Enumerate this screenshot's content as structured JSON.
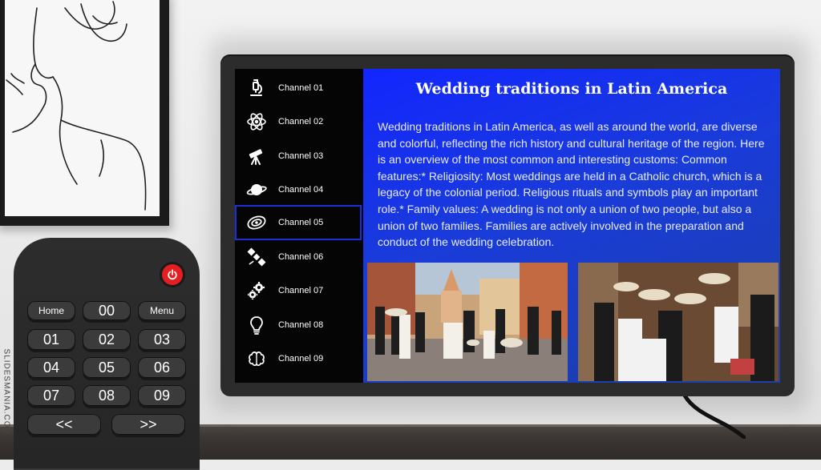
{
  "channels": [
    {
      "label": "Channel 01",
      "icon": "microscope-icon"
    },
    {
      "label": "Channel 02",
      "icon": "atom-icon"
    },
    {
      "label": "Channel 03",
      "icon": "telescope-icon"
    },
    {
      "label": "Channel 04",
      "icon": "planet-icon"
    },
    {
      "label": "Channel 05",
      "icon": "galaxy-icon",
      "active": true
    },
    {
      "label": "Channel 06",
      "icon": "satellite-icon"
    },
    {
      "label": "Channel 07",
      "icon": "gears-icon"
    },
    {
      "label": "Channel 08",
      "icon": "lightbulb-icon"
    },
    {
      "label": "Channel 09",
      "icon": "brain-icon"
    }
  ],
  "content": {
    "title": "Wedding traditions in Latin America",
    "body": "Wedding traditions in Latin America, as well as around the world, are diverse and colorful, reflecting the rich history and cultural heritage of the region. Here is an overview of the most common and interesting customs: Common features:* Religiosity: Most weddings are held in a Catholic church, which is a legacy of the colonial period. Religious rituals and symbols play an important role.* Family values: A wedding is not only a union of two people, but also a union of two families. Families are actively involved in the preparation and conduct of the wedding celebration."
  },
  "remote": {
    "home": "Home",
    "menu": "Menu",
    "zero": "00",
    "numbers": [
      "01",
      "02",
      "03",
      "04",
      "05",
      "06",
      "07",
      "08",
      "09"
    ],
    "prev": "<<",
    "next": ">>"
  },
  "brand": "SLIDESMANIA.COM",
  "colors": {
    "panel": "#1226ff",
    "active_outline": "#1b2fd6",
    "power": "#e51f1f"
  }
}
